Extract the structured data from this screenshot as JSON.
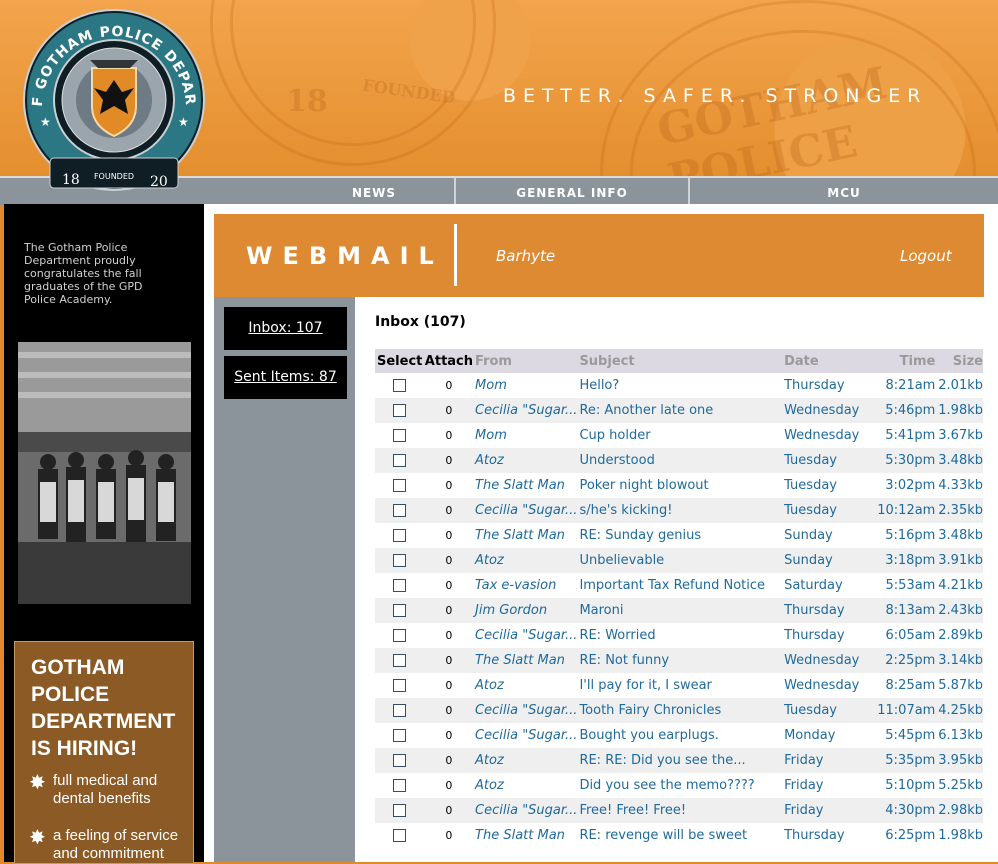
{
  "header": {
    "tagline": "BETTER. SAFER. STRONGER",
    "logo": {
      "ring_text": "CITY OF GOTHAM POLICE DEPARTMENT",
      "year_left": "18",
      "year_right": "20",
      "founded": "FOUNDED"
    }
  },
  "nav": {
    "items": [
      {
        "label": "NEWS"
      },
      {
        "label": "GENERAL INFO"
      },
      {
        "label": "MCU"
      }
    ]
  },
  "sidebar": {
    "congrats": "The Gotham Police Department proudly congratulates the fall graduates of the GPD Police Academy.",
    "ad": {
      "headline": [
        "GOTHAM",
        "POLICE",
        "DEPARTMENT",
        "IS HIRING!"
      ],
      "bullets": [
        "full medical and dental benefits",
        "a feeling of service and commitment"
      ]
    }
  },
  "webmail": {
    "title": "WEBMAIL",
    "user": "Barhyte",
    "logout": "Logout"
  },
  "folders": [
    {
      "label": "Inbox: 107"
    },
    {
      "label": "Sent Items: 87"
    }
  ],
  "inbox": {
    "title": "Inbox (107)",
    "columns": [
      "Select",
      "Attach",
      "From",
      "Subject",
      "Date",
      "Time",
      "Size"
    ],
    "messages": [
      {
        "attach": "0",
        "from": "Mom",
        "subject": "Hello?",
        "date": "Thursday",
        "time": "8:21am",
        "size": "2.01kb"
      },
      {
        "attach": "0",
        "from": "Cecilia \"Sugar...",
        "subject": "Re: Another late one",
        "date": "Wednesday",
        "time": "5:46pm",
        "size": "1.98kb"
      },
      {
        "attach": "0",
        "from": "Mom",
        "subject": "Cup holder",
        "date": "Wednesday",
        "time": "5:41pm",
        "size": "3.67kb"
      },
      {
        "attach": "0",
        "from": "Atoz",
        "subject": "Understood",
        "date": "Tuesday",
        "time": "5:30pm",
        "size": "3.48kb"
      },
      {
        "attach": "0",
        "from": "The Slatt Man",
        "subject": "Poker night blowout",
        "date": "Tuesday",
        "time": "3:02pm",
        "size": "4.33kb"
      },
      {
        "attach": "0",
        "from": "Cecilia \"Sugar...",
        "subject": "s/he's kicking!",
        "date": "Tuesday",
        "time": "10:12am",
        "size": "2.35kb"
      },
      {
        "attach": "0",
        "from": "The Slatt Man",
        "subject": "RE: Sunday genius",
        "date": "Sunday",
        "time": "5:16pm",
        "size": "3.48kb"
      },
      {
        "attach": "0",
        "from": "Atoz",
        "subject": "Unbelievable",
        "date": "Sunday",
        "time": "3:18pm",
        "size": "3.91kb"
      },
      {
        "attach": "0",
        "from": "Tax e-vasion",
        "subject": "Important Tax Refund Notice",
        "date": "Saturday",
        "time": "5:53am",
        "size": "4.21kb"
      },
      {
        "attach": "0",
        "from": "Jim Gordon",
        "subject": "Maroni",
        "date": "Thursday",
        "time": "8:13am",
        "size": "2.43kb"
      },
      {
        "attach": "0",
        "from": "Cecilia \"Sugar...",
        "subject": "RE: Worried",
        "date": "Thursday",
        "time": "6:05am",
        "size": "2.89kb"
      },
      {
        "attach": "0",
        "from": "The Slatt Man",
        "subject": "RE: Not funny",
        "date": "Wednesday",
        "time": "2:25pm",
        "size": "3.14kb"
      },
      {
        "attach": "0",
        "from": "Atoz",
        "subject": "I'll pay for it, I swear",
        "date": "Wednesday",
        "time": "8:25am",
        "size": "5.87kb"
      },
      {
        "attach": "0",
        "from": "Cecilia \"Sugar...",
        "subject": "Tooth Fairy Chronicles",
        "date": "Tuesday",
        "time": "11:07am",
        "size": "4.25kb"
      },
      {
        "attach": "0",
        "from": "Cecilia \"Sugar...",
        "subject": "Bought you earplugs.",
        "date": "Monday",
        "time": "5:45pm",
        "size": "6.13kb"
      },
      {
        "attach": "0",
        "from": "Atoz",
        "subject": "RE: RE: Did you see the...",
        "date": "Friday",
        "time": "5:35pm",
        "size": "3.95kb"
      },
      {
        "attach": "0",
        "from": "Atoz",
        "subject": "Did you see the memo????",
        "date": "Friday",
        "time": "5:10pm",
        "size": "5.25kb"
      },
      {
        "attach": "0",
        "from": "Cecilia \"Sugar...",
        "subject": "Free! Free! Free!",
        "date": "Friday",
        "time": "4:30pm",
        "size": "2.98kb"
      },
      {
        "attach": "0",
        "from": "The Slatt Man",
        "subject": "RE: revenge will be sweet",
        "date": "Thursday",
        "time": "6:25pm",
        "size": "1.98kb"
      }
    ]
  },
  "colors": {
    "orange": "#e08a2c",
    "header_orange": "#de8a33",
    "nav_gray": "#8b949b",
    "link_blue": "#1f6a9c",
    "ad_brown": "#8b5a25"
  }
}
